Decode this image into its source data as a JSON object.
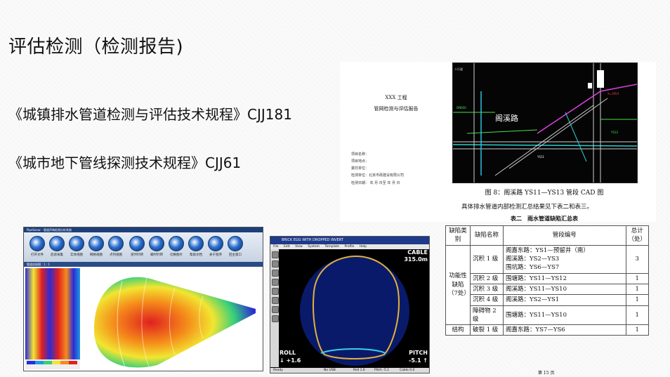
{
  "slide": {
    "title": "评估检测（检测报告)",
    "standard_1": "《城镇排水管道检测与评估技术规程》CJJ181",
    "standard_2": "《城市地下管线探测技术规程》CJJ61"
  },
  "report_cover": {
    "project": "XXX 工程",
    "report_title": "管网检测与评估报告",
    "fields": [
      "项目名称：",
      "项目地点：",
      "委托单位：",
      "检测单位：北京市政建设有限公司",
      "检测日期：    年    月    日至    年    月    日"
    ]
  },
  "cad": {
    "road_label": "阁溪路",
    "caption": "图 8：阁溪路 YS11—YS13 管段 CAD 图"
  },
  "summary_text": "具体排水管道内部检测汇总结果见下表二和表三。",
  "defect_table": {
    "caption": "表二　雨水管道缺陷汇总表",
    "headers": [
      "缺陷类别",
      "缺陷名称",
      "管段编号",
      "总计（处）"
    ],
    "category": "功能性缺陷（7处）",
    "rows": [
      {
        "name": "沉积 1 级",
        "segments": [
          "阁嘉东路：YS1—预留井（南）",
          "阁溪路：YS2—YS3",
          "围坑路：YS6—YS7"
        ],
        "count": "3"
      },
      {
        "name": "沉积 2 级",
        "segments": [
          "围塘路：YS11—YS12"
        ],
        "count": "1"
      },
      {
        "name": "沉积 3 级",
        "segments": [
          "阁溪路：YS11—YS10"
        ],
        "count": "1"
      },
      {
        "name": "沉积 4 级",
        "segments": [
          "阁溪路：YS2—YS1"
        ],
        "count": "1"
      },
      {
        "name": "障碍物 2 级",
        "segments": [
          "围塘路：YS11—YS10"
        ],
        "count": "1"
      }
    ],
    "last_row": {
      "category": "结构",
      "name": "破裂 1 级",
      "segment": "阁嘉东路：YS7—YS6",
      "count": "1"
    },
    "page": "第 15 页"
  },
  "pipe_software": {
    "window_title": "PipeSonar - 管道声呐检测分析系统",
    "buttons": [
      "打开文件",
      "后退采集",
      "实体视图",
      "网格视图",
      "点列视图",
      "逆时针转",
      "顺时针转",
      "切换图片",
      "帮助文档",
      "关于程序",
      "回主窗口"
    ],
    "status": "管道剖面图：1 : 1",
    "colors": [
      "#2b2bd6",
      "#1f9ae0",
      "#35d07a",
      "#f2e531",
      "#f58c1a",
      "#e02020"
    ]
  },
  "sonar_software": {
    "window_title": "BRICK EGG WITH DROPPED INVERT",
    "menu": [
      "File",
      "Edit",
      "View",
      "System",
      "Template",
      "Profile",
      "Help"
    ],
    "cable_label": "CABLE",
    "cable_value": "315.0m",
    "roll_label": "ROLL",
    "roll_value": "↓ +1.6",
    "pitch_label": "PITCH",
    "pitch_value": "-5.1 ↑",
    "status": [
      "Ready",
      "No USB",
      "Roll 1.6",
      "Pitch -5.1",
      "Cable 0.0"
    ]
  }
}
